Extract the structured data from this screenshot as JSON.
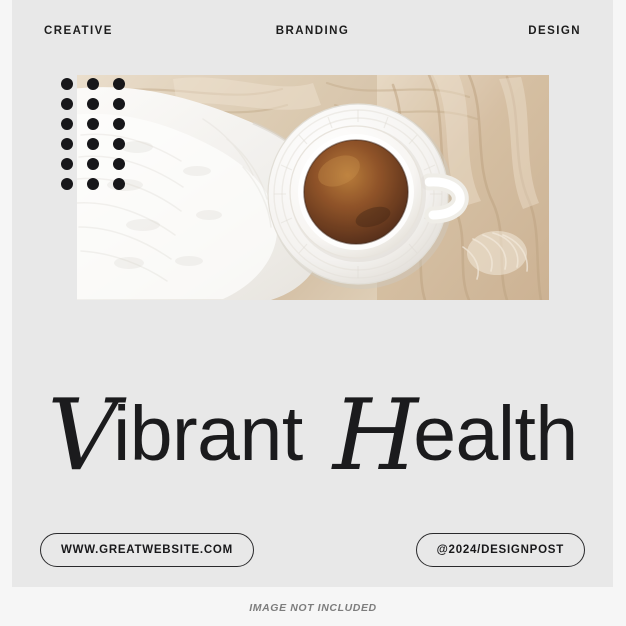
{
  "canvas": {
    "background_color": "#f6f6f6",
    "card_color": "#e8e8e8",
    "accent_color": "#17171a"
  },
  "header": {
    "left_label": "CREATIVE",
    "center_label": "BRANDING",
    "right_label": "DESIGN"
  },
  "decor": {
    "dot_grid": {
      "columns": 3,
      "rows": 6,
      "dot_color": "#17171a"
    }
  },
  "photo": {
    "alt": "Flat lay of a white ceramic cup of black tea on a saucer, resting on a white knit blanket beside crumpled beige linen fabric",
    "palette": {
      "linen_beige": "#d9c6ac",
      "linen_beige_light": "#e7dac8",
      "knit_white": "#f3f1ee",
      "cup_white": "#fbfafa",
      "tea_dark": "#4a2410",
      "tea_mid": "#86431a",
      "tea_light": "#b46a2c"
    }
  },
  "title": {
    "word_one_initial": "V",
    "word_one_rest": "ibrant",
    "word_two_initial": "H",
    "word_two_rest": "ealth",
    "full_text": "Vibrant Health"
  },
  "buttons": {
    "website_label": "WWW.GREATWEBSITE.COM",
    "handle_label": "@2024/DESIGNPOST"
  },
  "footer": {
    "note": "IMAGE NOT INCLUDED"
  }
}
